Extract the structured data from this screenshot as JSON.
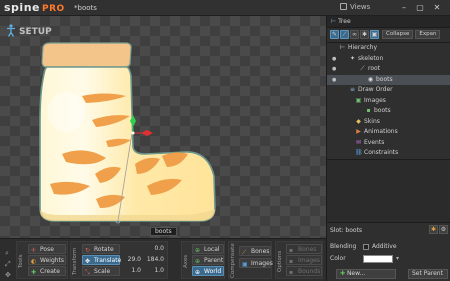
{
  "app": {
    "logo_text": "spine",
    "logo_edition": "PRO",
    "project_name": "*boots",
    "views_label": "Views",
    "minimize": "–",
    "maximize": "▢",
    "close": "✕"
  },
  "viewport": {
    "mode_label": "SETUP",
    "selected_label": "boots"
  },
  "toolbar": {
    "tools": {
      "title": "Tools",
      "pose": "Pose",
      "weights": "Weights",
      "create": "Create"
    },
    "transform": {
      "title": "Transform",
      "rotate": "Rotate",
      "rotate_value": "0.0",
      "translate": "Translate",
      "translate_x": "29.0",
      "translate_y": "184.0",
      "scale": "Scale",
      "scale_x": "1.0",
      "scale_y": "1.0"
    },
    "axes": {
      "title": "Axes",
      "local": "Local",
      "parent": "Parent",
      "world": "World"
    },
    "compensate": {
      "title": "Compensate",
      "bones": "Bones",
      "images": "Images"
    },
    "options": {
      "title": "Options",
      "bones": "Bones",
      "images": "Images",
      "bounds": "Bounds"
    }
  },
  "panel": {
    "tab_label": "Tree",
    "collapse_label": "Collapse",
    "expand_label": "Expan",
    "tree": {
      "hierarchy": "Hierarchy",
      "skeleton": "skeleton",
      "root": "root",
      "boots_slot": "boots",
      "draw_order": "Draw Order",
      "images": "Images",
      "boots_image": "boots",
      "skins": "Skins",
      "animations": "Animations",
      "events": "Events",
      "constraints": "Constraints"
    },
    "slot": {
      "title": "Slot: boots",
      "blending_label": "Blending",
      "blending_value": "Additive",
      "color_label": "Color",
      "color_value": "#ffffff",
      "new_label": "New...",
      "set_parent_label": "Set Parent"
    }
  },
  "colors": {
    "accent": "#3a6a8e",
    "logo_pro": "#ff7a2b",
    "bone_axis_y": "#2fd04a",
    "bone_axis_x": "#e03030",
    "boot_fill": "#ffe9a8",
    "boot_stripe": "#f0a04a",
    "boot_outline": "#7b9c8e"
  }
}
